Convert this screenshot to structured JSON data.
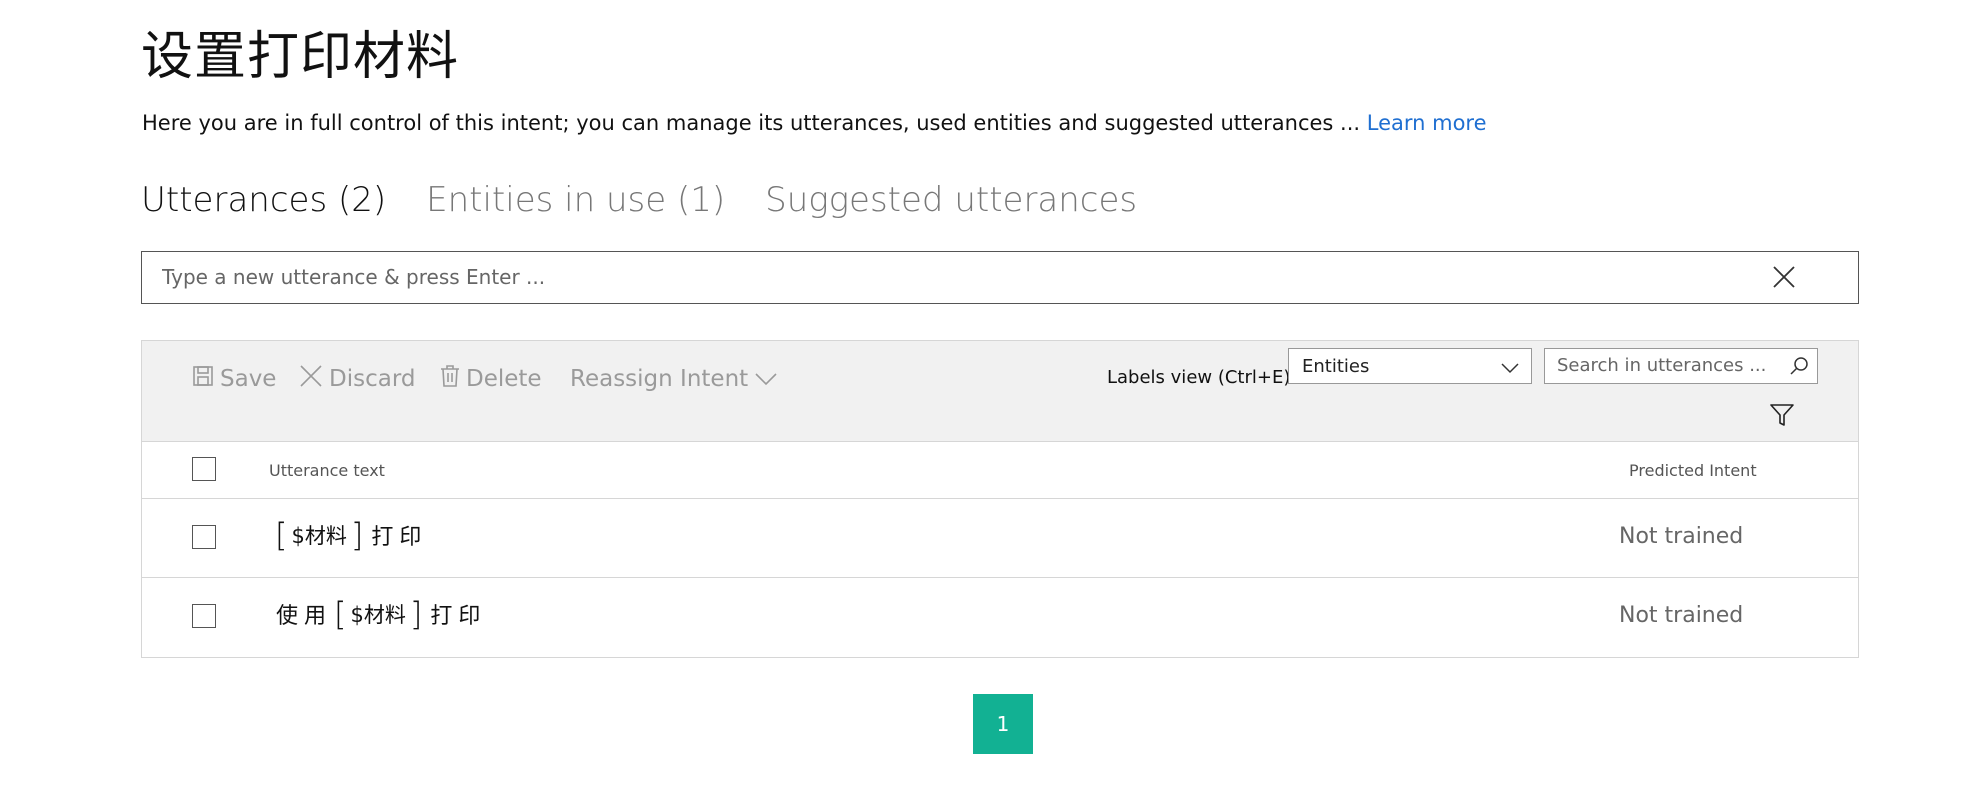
{
  "page": {
    "title": "设置打印材料",
    "description": "Here you are in full control of this intent; you can manage its utterances, used entities and suggested utterances ... ",
    "learn_more": "Learn more"
  },
  "tabs": [
    {
      "label": "Utterances (2)",
      "active": true
    },
    {
      "label": "Entities in use (1)",
      "active": false
    },
    {
      "label": "Suggested utterances",
      "active": false
    }
  ],
  "new_utterance": {
    "placeholder": "Type a new utterance & press Enter ..."
  },
  "toolbar": {
    "save": "Save",
    "discard": "Discard",
    "delete": "Delete",
    "reassign": "Reassign Intent",
    "labels_view_label": "Labels view (Ctrl+E):",
    "labels_view_value": "Entities",
    "search_placeholder": "Search in utterances ..."
  },
  "table": {
    "col_utterance": "Utterance text",
    "col_predicted": "Predicted Intent",
    "rows": [
      {
        "before": "",
        "entity": "$材料",
        "after": "打印",
        "predicted": "Not trained"
      },
      {
        "before": "使用",
        "entity": "$材料",
        "after": "打印",
        "predicted": "Not trained"
      }
    ]
  },
  "pager": {
    "current": "1"
  },
  "colors": {
    "accent": "#12b193",
    "link": "#1f6fd1",
    "toolbar_bg": "#f1f1f1"
  }
}
